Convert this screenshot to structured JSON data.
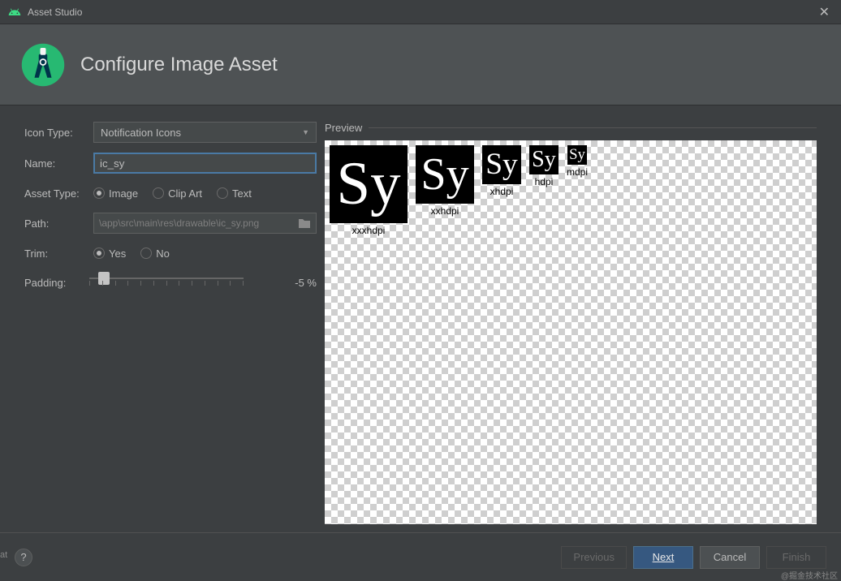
{
  "window": {
    "title": "Asset Studio"
  },
  "header": {
    "title": "Configure Image Asset"
  },
  "form": {
    "iconType": {
      "label": "Icon Type:",
      "value": "Notification Icons"
    },
    "name": {
      "label": "Name:",
      "value": "ic_sy"
    },
    "assetType": {
      "label": "Asset Type:",
      "options": [
        {
          "label": "Image",
          "selected": true
        },
        {
          "label": "Clip Art",
          "selected": false
        },
        {
          "label": "Text",
          "selected": false
        }
      ]
    },
    "path": {
      "label": "Path:",
      "value": "\\app\\src\\main\\res\\drawable\\ic_sy.png"
    },
    "trim": {
      "label": "Trim:",
      "options": [
        {
          "label": "Yes",
          "selected": true
        },
        {
          "label": "No",
          "selected": false
        }
      ]
    },
    "padding": {
      "label": "Padding:",
      "value": "-5 %"
    }
  },
  "preview": {
    "legend": "Preview",
    "glyph": "Sy",
    "items": [
      {
        "label": "xxxhdpi",
        "size": 96
      },
      {
        "label": "xxhdpi",
        "size": 72
      },
      {
        "label": "xhdpi",
        "size": 48
      },
      {
        "label": "hdpi",
        "size": 36
      },
      {
        "label": "mdpi",
        "size": 24
      }
    ]
  },
  "footer": {
    "previous": "Previous",
    "next": "Next",
    "cancel": "Cancel",
    "finish": "Finish"
  },
  "watermark": "@掘金技术社区",
  "cutLabel": "at"
}
